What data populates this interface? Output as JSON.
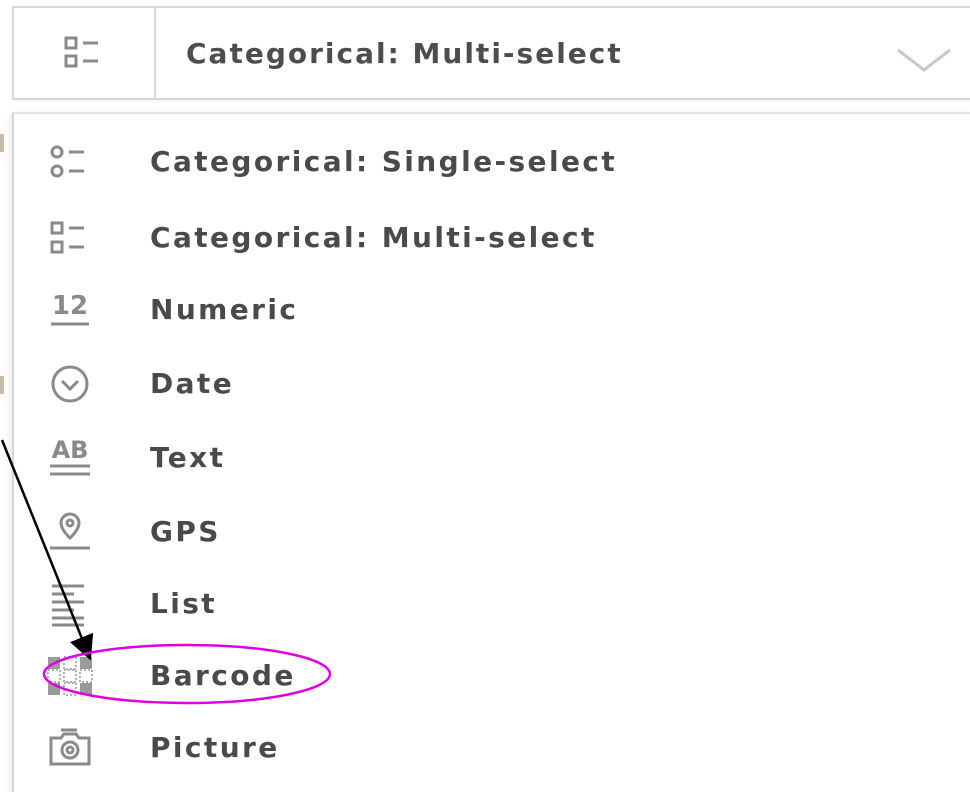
{
  "field_type_select": {
    "selected_value": "Categorical: Multi-select",
    "selected_icon": "multi-select-icon",
    "caret_icon": "chevron-down-icon"
  },
  "dropdown": {
    "options": [
      {
        "label": "Categorical: Single-select",
        "icon": "single-select-icon"
      },
      {
        "label": "Categorical: Multi-select",
        "icon": "multi-select-icon"
      },
      {
        "label": "Numeric",
        "icon": "numeric-icon"
      },
      {
        "label": "Date",
        "icon": "clock-icon"
      },
      {
        "label": "Text",
        "icon": "text-icon"
      },
      {
        "label": "GPS",
        "icon": "location-pin-icon"
      },
      {
        "label": "List",
        "icon": "list-icon"
      },
      {
        "label": "Barcode",
        "icon": "barcode-grid-icon"
      },
      {
        "label": "Picture",
        "icon": "camera-icon"
      }
    ]
  },
  "icon_glyphs": {
    "numeric": "12",
    "text": "AB"
  },
  "annotation": {
    "highlight_target": "Barcode",
    "ellipse_color": "#e000e0",
    "arrow_color": "#000000"
  }
}
